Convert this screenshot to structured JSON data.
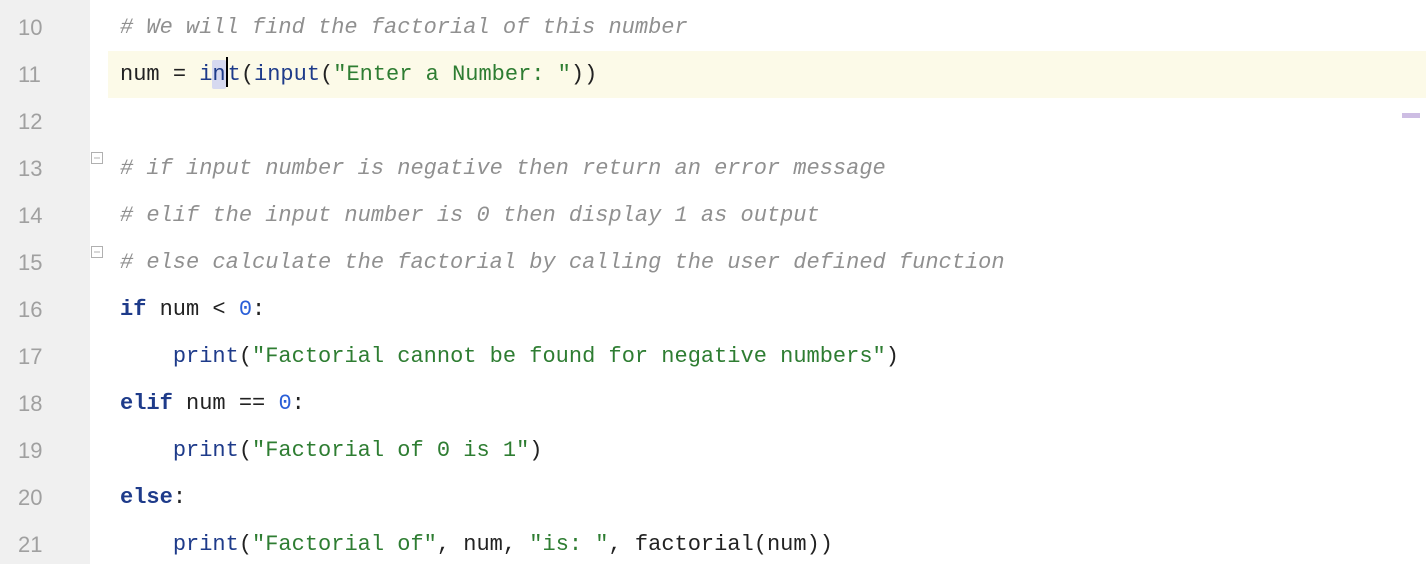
{
  "gutter": {
    "lines": [
      "10",
      "11",
      "12",
      "13",
      "14",
      "15",
      "16",
      "17",
      "18",
      "19",
      "20",
      "21"
    ]
  },
  "code": {
    "l10": {
      "comment": "# We will find the factorial of this number"
    },
    "l11": {
      "ident1": "num ",
      "op": "= ",
      "builtin1_a": "i",
      "builtin1_b": "n",
      "builtin1_c": "t",
      "p1": "(",
      "builtin2": "input",
      "p2": "(",
      "str": "\"Enter a Number: \"",
      "p3": "))"
    },
    "l13": {
      "comment": "# if input number is negative then return an error message"
    },
    "l14": {
      "comment": "# elif the input number is 0 then display 1 as output"
    },
    "l15": {
      "comment": "# else calculate the factorial by calling the user defined function"
    },
    "l16": {
      "kw": "if ",
      "ident": "num ",
      "op": "< ",
      "num": "0",
      "colon": ":"
    },
    "l17": {
      "indent": "    ",
      "func": "print",
      "p1": "(",
      "str": "\"Factorial cannot be found for negative numbers\"",
      "p2": ")"
    },
    "l18": {
      "kw": "elif ",
      "ident": "num ",
      "op": "== ",
      "num": "0",
      "colon": ":"
    },
    "l19": {
      "indent": "    ",
      "func": "print",
      "p1": "(",
      "str": "\"Factorial of 0 is 1\"",
      "p2": ")"
    },
    "l20": {
      "kw": "else",
      "colon": ":"
    },
    "l21": {
      "indent": "    ",
      "func": "print",
      "p1": "(",
      "str1": "\"Factorial of\"",
      "comma1": ", ",
      "ident1": "num",
      "comma2": ", ",
      "str2": "\"is: \"",
      "comma3": ", ",
      "call": "factorial",
      "p2": "(",
      "ident2": "num",
      "p3": "))"
    }
  },
  "fold": {
    "open": "⊟",
    "close": "⊟"
  }
}
